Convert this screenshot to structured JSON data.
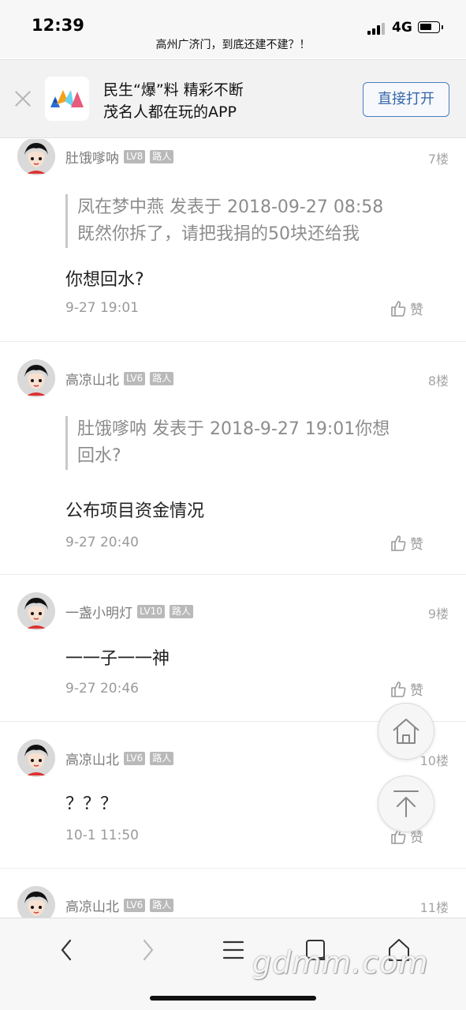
{
  "status_bar": {
    "time": "12:39",
    "network": "4G"
  },
  "page": {
    "title": "高州广济门，到底还建不建？！"
  },
  "banner": {
    "line1": "民生“爆”料 精彩不断",
    "line2": "茂名人都在玩的APP",
    "open_button": "直接打开"
  },
  "comments": [
    {
      "username": "肚饿嗲呐",
      "level": "LV8",
      "role": "路人",
      "floor": "7楼",
      "quote": "凤在梦中燕  发表于  2018-09-27  08:58\n既然你拆了，请把我捐的50块还给我",
      "content": "你想回水?",
      "time": "9-27 19:01",
      "like": "赞"
    },
    {
      "username": "高凉山北",
      "level": "LV6",
      "role": "路人",
      "floor": "8楼",
      "quote": "肚饿嗲呐  发表于  2018-9-27  19:01你想\n回水?",
      "content": "公布项目资金情况",
      "time": "9-27 20:40",
      "like": "赞"
    },
    {
      "username": "一盏小明灯",
      "level": "LV10",
      "role": "路人",
      "floor": "9楼",
      "content": "一一子一一神",
      "time": "9-27 20:46",
      "like": "赞"
    },
    {
      "username": "高凉山北",
      "level": "LV6",
      "role": "路人",
      "floor": "10楼",
      "content": "？？？",
      "time": "10-1 11:50",
      "like": "赞"
    },
    {
      "username": "高凉山北",
      "level": "LV6",
      "role": "路人",
      "floor": "11楼"
    }
  ],
  "floating": {
    "home_icon": "home-icon",
    "top_icon": "back-to-top-icon"
  },
  "toolbar": {
    "icons": [
      "back-arrow-icon",
      "forward-arrow-icon",
      "menu-icon",
      "tabs-icon",
      "home-icon"
    ],
    "watermark": "gdmm.com"
  },
  "colors": {
    "accent": "#3566aa",
    "badge": "#b9b9b9",
    "meta_text": "#9a9a9a"
  }
}
